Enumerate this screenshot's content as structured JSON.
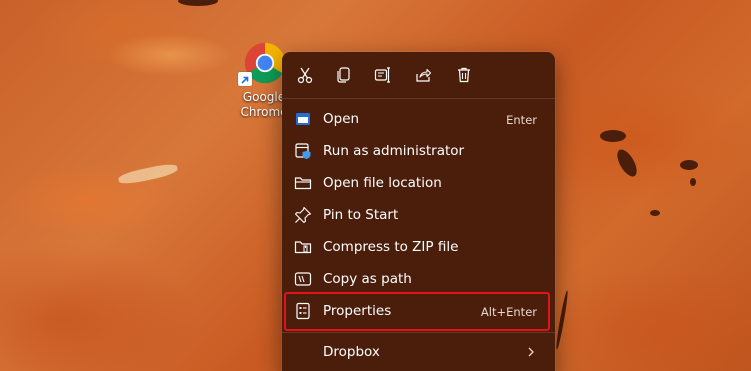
{
  "desktop": {
    "icon": {
      "name": "chrome-icon",
      "label_line1": "Google",
      "label_line2": "Chrome"
    }
  },
  "context_menu": {
    "toolbar": [
      {
        "name": "cut-icon",
        "label": "Cut"
      },
      {
        "name": "copy-icon",
        "label": "Copy"
      },
      {
        "name": "rename-icon",
        "label": "Rename"
      },
      {
        "name": "share-icon",
        "label": "Share"
      },
      {
        "name": "delete-icon",
        "label": "Delete"
      }
    ],
    "items": [
      {
        "label": "Open",
        "shortcut": "Enter",
        "icon": "open-window-icon"
      },
      {
        "label": "Run as administrator",
        "shortcut": "",
        "icon": "shield-icon"
      },
      {
        "label": "Open file location",
        "shortcut": "",
        "icon": "folder-icon"
      },
      {
        "label": "Pin to Start",
        "shortcut": "",
        "icon": "pin-icon"
      },
      {
        "label": "Compress to ZIP file",
        "shortcut": "",
        "icon": "zip-folder-icon"
      },
      {
        "label": "Copy as path",
        "shortcut": "",
        "icon": "copy-path-icon"
      },
      {
        "label": "Properties",
        "shortcut": "Alt+Enter",
        "icon": "properties-icon"
      },
      {
        "label": "Dropbox",
        "shortcut": "",
        "icon": "dropbox-icon",
        "submenu": true
      }
    ],
    "highlighted_item": "Properties"
  },
  "colors": {
    "menu_background": "#4b1e0c",
    "highlight_border": "#e3131b",
    "accent_blue": "#3b9cf0"
  }
}
